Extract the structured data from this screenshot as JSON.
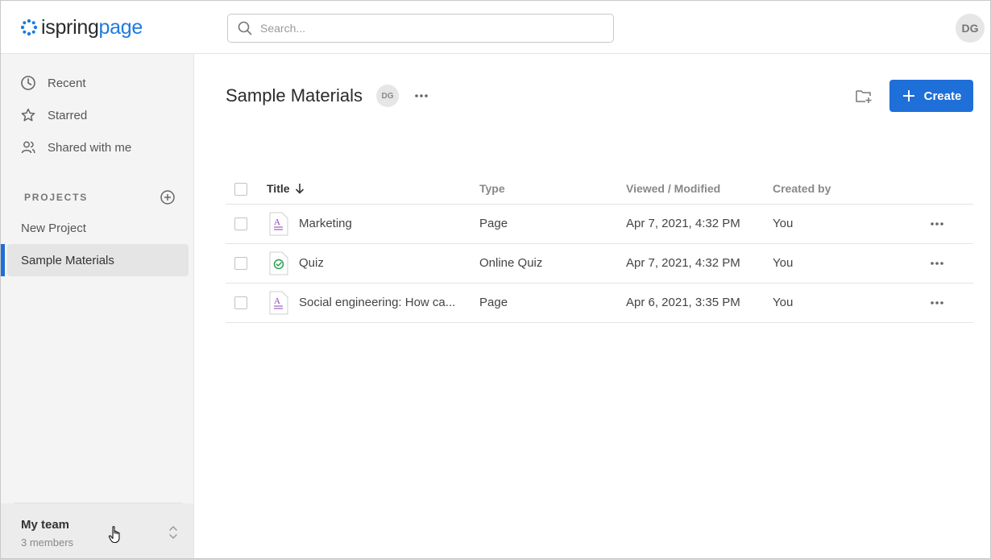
{
  "app": {
    "logo_part1": "ispring",
    "logo_part2": "page",
    "brand_color": "#1f7ae0",
    "accent_color": "#1f6fd8"
  },
  "search": {
    "placeholder": "Search...",
    "value": ""
  },
  "user": {
    "initials": "DG"
  },
  "sidebar": {
    "nav": [
      {
        "label": "Recent",
        "icon": "clock-icon"
      },
      {
        "label": "Starred",
        "icon": "star-icon"
      },
      {
        "label": "Shared with me",
        "icon": "users-icon"
      }
    ],
    "projects_label": "PROJECTS",
    "projects": [
      {
        "label": "New Project",
        "active": false
      },
      {
        "label": "Sample Materials",
        "active": true
      }
    ],
    "team": {
      "name": "My team",
      "members": "3 members"
    }
  },
  "main": {
    "title": "Sample Materials",
    "owner_initials": "DG",
    "create_label": "Create",
    "columns": {
      "title": "Title",
      "type": "Type",
      "viewed": "Viewed / Modified",
      "created_by": "Created by"
    },
    "rows": [
      {
        "title": "Marketing",
        "type": "Page",
        "date": "Apr 7, 2021, 4:32 PM",
        "created_by": "You",
        "icon": "page-file-icon"
      },
      {
        "title": "Quiz",
        "type": "Online Quiz",
        "date": "Apr 7, 2021, 4:32 PM",
        "created_by": "You",
        "icon": "quiz-file-icon"
      },
      {
        "title": "Social engineering: How ca...",
        "type": "Page",
        "date": "Apr 6, 2021, 3:35 PM",
        "created_by": "You",
        "icon": "page-file-icon"
      }
    ]
  }
}
